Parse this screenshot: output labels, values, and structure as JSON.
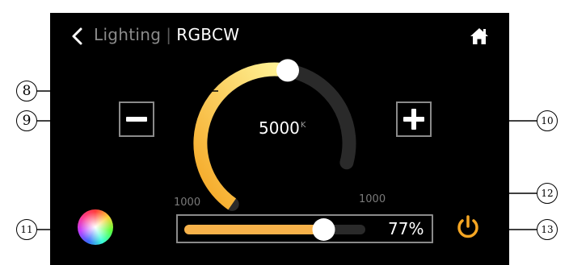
{
  "header": {
    "section": "Lighting",
    "separator": "|",
    "current": "RGBCW",
    "back_icon": "chevron-left-icon",
    "home_icon": "home-icon"
  },
  "cct_control": {
    "value": "5000",
    "unit": "K",
    "min_label": "1000",
    "max_label": "1000",
    "level_fraction": 0.62,
    "minus_icon": "minus-icon",
    "plus_icon": "plus-icon"
  },
  "brightness": {
    "display": "77%",
    "value_percent": 77
  },
  "actions": {
    "color_wheel_icon": "color-wheel-icon",
    "power_icon": "power-icon"
  },
  "callouts": {
    "c8": "8",
    "c9": "9",
    "c10": "10",
    "c11": "11",
    "c12": "12",
    "c13": "13"
  },
  "colors": {
    "arc_start": "#f5a623",
    "arc_end": "#fff59a",
    "track": "#2a2a2a",
    "slider_fill": "#f7b24a",
    "power": "#f5a623"
  }
}
